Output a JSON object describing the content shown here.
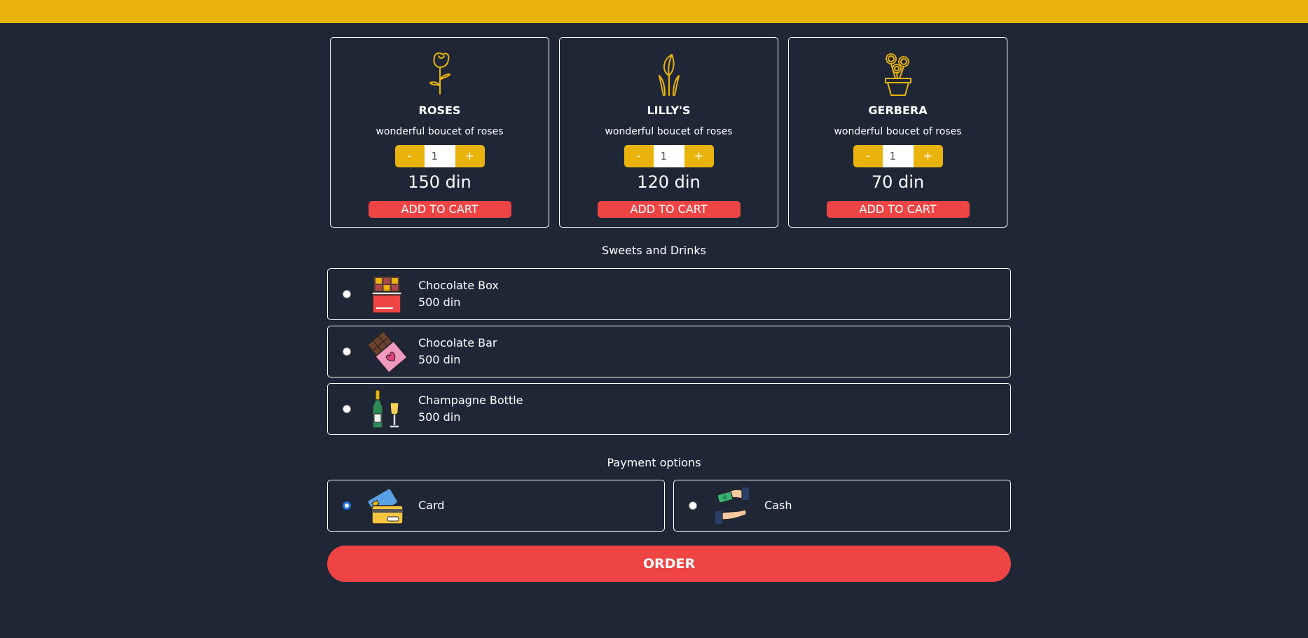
{
  "products": [
    {
      "name": "ROSES",
      "description": "wonderful boucet of roses",
      "minus": "-",
      "quantity": "1",
      "plus": "+",
      "price": "150 din",
      "add_label": "ADD TO CART",
      "icon": "rose-icon"
    },
    {
      "name": "LILLY'S",
      "description": "wonderful boucet of roses",
      "minus": "-",
      "quantity": "1",
      "plus": "+",
      "price": "120 din",
      "add_label": "ADD TO CART",
      "icon": "lily-icon"
    },
    {
      "name": "GERBERA",
      "description": "wonderful boucet of roses",
      "minus": "-",
      "quantity": "1",
      "plus": "+",
      "price": "70 din",
      "add_label": "ADD TO CART",
      "icon": "potted-flower-icon"
    }
  ],
  "sweets": {
    "title": "Sweets and Drinks",
    "items": [
      {
        "name": "Chocolate Box",
        "price": "500 din",
        "icon": "chocolate-box-icon",
        "selected": false
      },
      {
        "name": "Chocolate Bar",
        "price": "500 din",
        "icon": "chocolate-bar-icon",
        "selected": false
      },
      {
        "name": "Champagne Bottle",
        "price": "500 din",
        "icon": "champagne-icon",
        "selected": false
      }
    ]
  },
  "payment": {
    "title": "Payment options",
    "options": [
      {
        "label": "Card",
        "icon": "credit-card-icon",
        "selected": true
      },
      {
        "label": "Cash",
        "icon": "cash-hand-icon",
        "selected": false
      }
    ]
  },
  "order_label": "ORDER",
  "colors": {
    "background": "#1f2737",
    "accent": "#e9b30c",
    "button": "#ef4444",
    "text": "#ffffff",
    "radio_selected": "#1e6fe0"
  }
}
